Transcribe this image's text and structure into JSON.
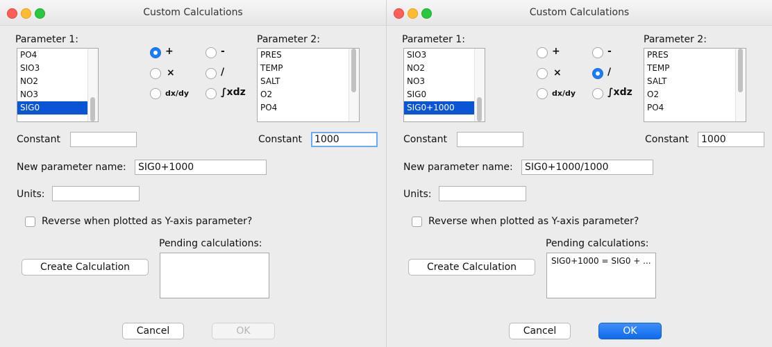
{
  "dialogs": [
    {
      "title": "Custom Calculations",
      "parameter1_label": "Parameter 1:",
      "parameter2_label": "Parameter 2:",
      "parameter1_items": [
        "PO4",
        "SIO3",
        "NO2",
        "NO3",
        "SIG0"
      ],
      "parameter1_selected": "SIG0",
      "parameter1_scroll": {
        "thumb_start": 0.67,
        "thumb_size": 0.33
      },
      "parameter2_items": [
        "PRES",
        "TEMP",
        "SALT",
        "O2",
        "PO4"
      ],
      "parameter2_selected": "",
      "parameter2_scroll": {
        "thumb_start": 0.0,
        "thumb_size": 0.6
      },
      "operations": [
        {
          "symbol": "+",
          "name": "add",
          "selected": true
        },
        {
          "symbol": "-",
          "name": "subtract",
          "selected": false
        },
        {
          "symbol": "×",
          "name": "multiply",
          "selected": false
        },
        {
          "symbol": "/",
          "name": "divide",
          "selected": false
        },
        {
          "symbol": "dx/dy",
          "name": "derivative",
          "selected": false
        },
        {
          "symbol": "∫xdz",
          "name": "integral",
          "selected": false
        }
      ],
      "constant1_label": "Constant",
      "constant1_value": "",
      "constant2_label": "Constant",
      "constant2_value": "1000",
      "constant2_focused": true,
      "new_param_label": "New parameter name:",
      "new_param_value": "SIG0+1000",
      "units_label": "Units:",
      "units_value": "",
      "reverse_label": "Reverse when plotted as Y-axis parameter?",
      "reverse_checked": false,
      "pending_label": "Pending calculations:",
      "pending_items": [],
      "create_label": "Create Calculation",
      "cancel_label": "Cancel",
      "ok_label": "OK",
      "ok_enabled": false
    },
    {
      "title": "Custom Calculations",
      "parameter1_label": "Parameter 1:",
      "parameter2_label": "Parameter 2:",
      "parameter1_items": [
        "SIO3",
        "NO2",
        "NO3",
        "SIG0",
        "SIG0+1000"
      ],
      "parameter1_selected": "SIG0+1000",
      "parameter1_scroll": {
        "thumb_start": 0.67,
        "thumb_size": 0.33
      },
      "parameter2_items": [
        "PRES",
        "TEMP",
        "SALT",
        "O2",
        "PO4"
      ],
      "parameter2_selected": "",
      "parameter2_scroll": {
        "thumb_start": 0.0,
        "thumb_size": 0.6
      },
      "operations": [
        {
          "symbol": "+",
          "name": "add",
          "selected": false
        },
        {
          "symbol": "-",
          "name": "subtract",
          "selected": false
        },
        {
          "symbol": "×",
          "name": "multiply",
          "selected": false
        },
        {
          "symbol": "/",
          "name": "divide",
          "selected": true
        },
        {
          "symbol": "dx/dy",
          "name": "derivative",
          "selected": false
        },
        {
          "symbol": "∫xdz",
          "name": "integral",
          "selected": false
        }
      ],
      "constant1_label": "Constant",
      "constant1_value": "",
      "constant2_label": "Constant",
      "constant2_value": "1000",
      "constant2_focused": false,
      "new_param_label": "New parameter name:",
      "new_param_value": "SIG0+1000/1000",
      "units_label": "Units:",
      "units_value": "",
      "reverse_label": "Reverse when plotted as Y-axis parameter?",
      "reverse_checked": false,
      "pending_label": "Pending calculations:",
      "pending_items": [
        "SIG0+1000 = SIG0 + ..."
      ],
      "create_label": "Create Calculation",
      "cancel_label": "Cancel",
      "ok_label": "OK",
      "ok_enabled": true
    }
  ]
}
